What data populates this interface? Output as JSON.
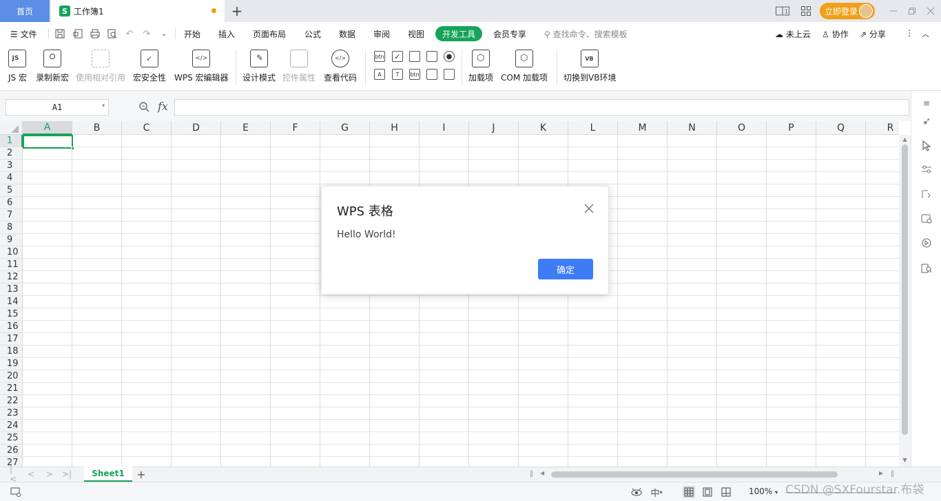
{
  "titlebar": {
    "home_tab": "首页",
    "doc_tab": {
      "logo": "S",
      "name": "工作簿1"
    },
    "new_tab_icon": "+",
    "login_button": "立即登录",
    "colors": {
      "home_tab_bg": "#5b8ee6",
      "login_bg": "#f0a019",
      "modified_dot": "#f29b1d"
    }
  },
  "menu": {
    "file_label": "文件",
    "tabs": [
      "开始",
      "插入",
      "页面布局",
      "公式",
      "数据",
      "审阅",
      "视图",
      "开发工具",
      "会员专享"
    ],
    "active_tab": "开发工具",
    "search_placeholder": "查找命令、搜索模板",
    "cloud_label": "未上云",
    "collab_label": "协作",
    "share_label": "分享",
    "accent": "#16a35a"
  },
  "ribbon": {
    "js_macro": "JS 宏",
    "record_macro": "录制新宏",
    "relative_ref": "使用相对引用",
    "macro_security": "宏安全性",
    "wps_macro_editor": "WPS 宏编辑器",
    "design_mode": "设计模式",
    "control_props": "控件属性",
    "view_code": "查看代码",
    "addins": "加载项",
    "com_addins": "COM 加载项",
    "switch_vb": "切换到VB环境",
    "ctl_btn": "btn",
    "ctl_text_a": "A",
    "ctl_text_t": "T",
    "vb_tag": "VB"
  },
  "formula_bar": {
    "name_box": "A1",
    "fx_label": "fx",
    "formula_value": ""
  },
  "grid": {
    "columns": [
      "A",
      "B",
      "C",
      "D",
      "E",
      "F",
      "G",
      "H",
      "I",
      "J",
      "K",
      "L",
      "M",
      "N",
      "O",
      "P",
      "Q",
      "R"
    ],
    "rows": [
      "1",
      "2",
      "3",
      "4",
      "5",
      "6",
      "7",
      "8",
      "9",
      "10",
      "11",
      "12",
      "13",
      "14",
      "15",
      "16",
      "17",
      "18",
      "19",
      "20",
      "21",
      "22",
      "23",
      "24",
      "25",
      "26",
      "27"
    ],
    "selected_column": "A",
    "selected_row": "1"
  },
  "sheets": {
    "tabs": [
      "Sheet1"
    ],
    "active": "Sheet1",
    "add_icon": "+"
  },
  "statusbar": {
    "zoom": "100%",
    "zoom_minus": "-"
  },
  "dialog": {
    "title": "WPS 表格",
    "message": "Hello World!",
    "ok_label": "确定",
    "ok_color": "#3d7cf5"
  },
  "watermark": "CSDN @SXFourstar.布袋"
}
